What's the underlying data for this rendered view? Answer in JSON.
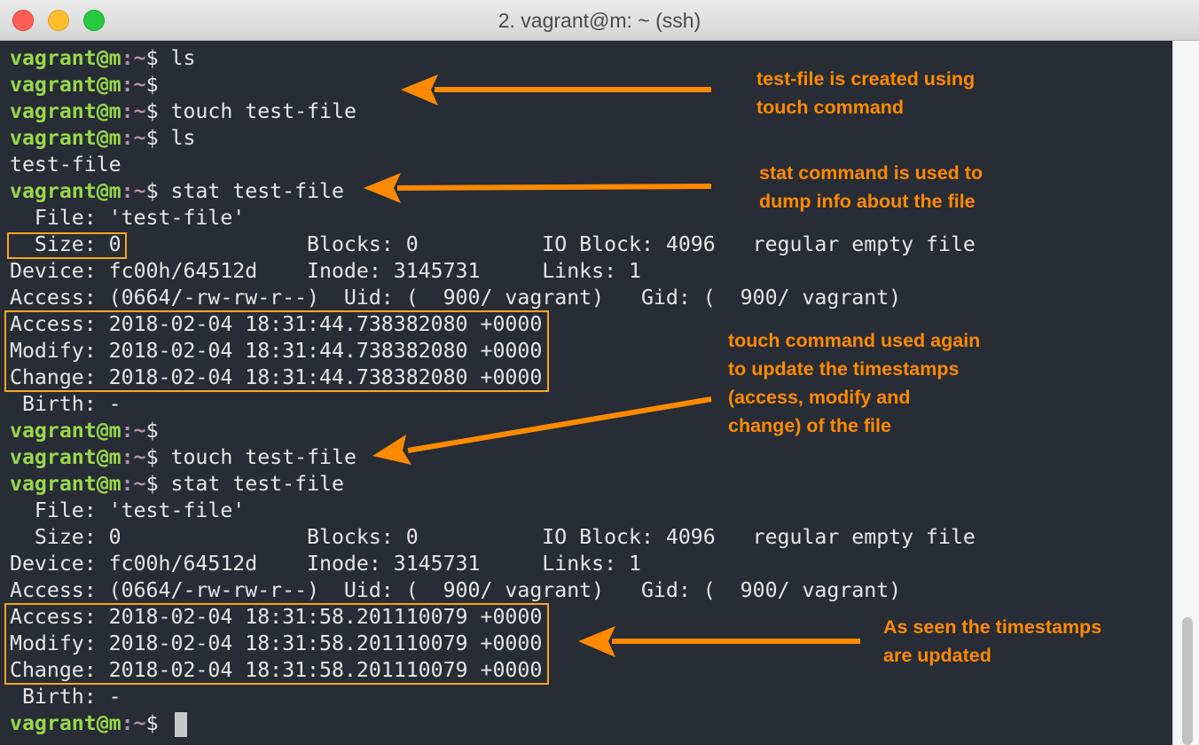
{
  "window": {
    "title": "2. vagrant@m: ~ (ssh)"
  },
  "terminal": {
    "user_host": "vagrant@m",
    "colon": ":",
    "path": "~",
    "prompt_symbol": "$",
    "lines": {
      "l1": " ls",
      "l2": "",
      "l3": " touch test-file",
      "l4": " ls",
      "l5": "test-file",
      "l6": " stat test-file",
      "l7": "  File: 'test-file'",
      "l8": "  Size: 0               Blocks: 0          IO Block: 4096   regular empty file",
      "l9": "Device: fc00h/64512d    Inode: 3145731     Links: 1",
      "l10": "Access: (0664/-rw-rw-r--)  Uid: (  900/ vagrant)   Gid: (  900/ vagrant)",
      "l11": "Access: 2018-02-04 18:31:44.738382080 +0000",
      "l12": "Modify: 2018-02-04 18:31:44.738382080 +0000",
      "l13": "Change: 2018-02-04 18:31:44.738382080 +0000",
      "l14": " Birth: -",
      "l15": "",
      "l16": " touch test-file",
      "l17": " stat test-file",
      "l18": "  File: 'test-file'",
      "l19": "  Size: 0               Blocks: 0          IO Block: 4096   regular empty file",
      "l20": "Device: fc00h/64512d    Inode: 3145731     Links: 1",
      "l21": "Access: (0664/-rw-rw-r--)  Uid: (  900/ vagrant)   Gid: (  900/ vagrant)",
      "l22": "Access: 2018-02-04 18:31:58.201110079 +0000",
      "l23": "Modify: 2018-02-04 18:31:58.201110079 +0000",
      "l24": "Change: 2018-02-04 18:31:58.201110079 +0000",
      "l25": " Birth: -",
      "l26": " "
    }
  },
  "annotations": {
    "note1": "test-file is created using\ntouch command",
    "note2": "stat command is used to\ndump info about the file",
    "note3": "touch command used again\nto update the timestamps\n(access, modify and\nchange) of the file",
    "note4": "As seen the timestamps\nare updated",
    "accent_color": "#ff8a00"
  },
  "colors": {
    "background": "#282c34",
    "user": "#98d84a",
    "path": "#b48ead",
    "text": "#e6e6e6"
  }
}
